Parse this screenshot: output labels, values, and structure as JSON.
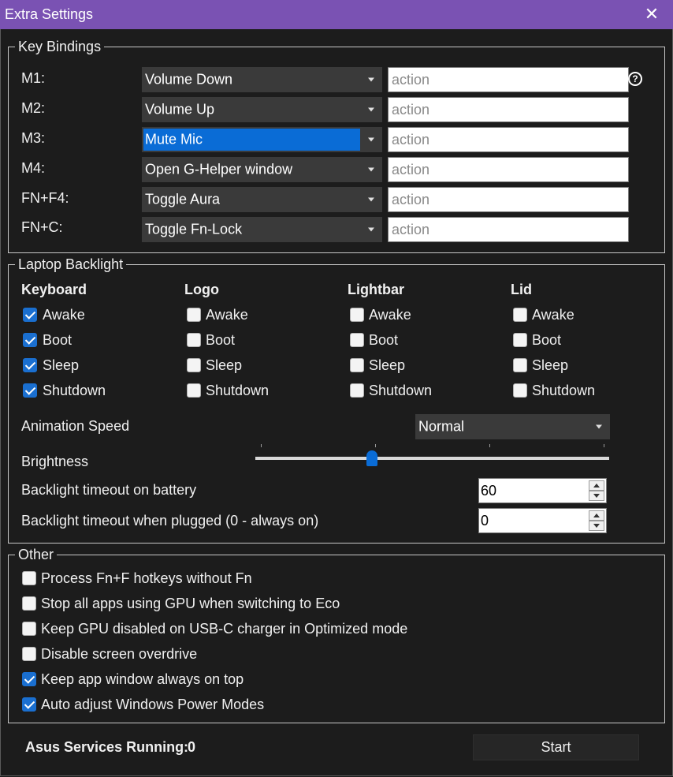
{
  "window": {
    "title": "Extra Settings",
    "close_glyph": "✕"
  },
  "key_bindings": {
    "legend": "Key Bindings",
    "help_glyph": "?",
    "rows": [
      {
        "label": "M1:",
        "action": "Volume Down",
        "placeholder": "action",
        "selected": false
      },
      {
        "label": "M2:",
        "action": "Volume Up",
        "placeholder": "action",
        "selected": false
      },
      {
        "label": "M3:",
        "action": "Mute Mic",
        "placeholder": "action",
        "selected": true
      },
      {
        "label": "M4:",
        "action": "Open G-Helper window",
        "placeholder": "action",
        "selected": false
      },
      {
        "label": "FN+F4:",
        "action": "Toggle Aura",
        "placeholder": "action",
        "selected": false
      },
      {
        "label": "FN+C:",
        "action": "Toggle Fn-Lock",
        "placeholder": "action",
        "selected": false
      }
    ]
  },
  "backlight": {
    "legend": "Laptop Backlight",
    "columns": [
      {
        "header": "Keyboard",
        "items": [
          {
            "label": "Awake",
            "checked": true
          },
          {
            "label": "Boot",
            "checked": true
          },
          {
            "label": "Sleep",
            "checked": true
          },
          {
            "label": "Shutdown",
            "checked": true
          }
        ]
      },
      {
        "header": "Logo",
        "items": [
          {
            "label": "Awake",
            "checked": false
          },
          {
            "label": "Boot",
            "checked": false
          },
          {
            "label": "Sleep",
            "checked": false
          },
          {
            "label": "Shutdown",
            "checked": false
          }
        ]
      },
      {
        "header": "Lightbar",
        "items": [
          {
            "label": "Awake",
            "checked": false
          },
          {
            "label": "Boot",
            "checked": false
          },
          {
            "label": "Sleep",
            "checked": false
          },
          {
            "label": "Shutdown",
            "checked": false
          }
        ]
      },
      {
        "header": "Lid",
        "items": [
          {
            "label": "Awake",
            "checked": false
          },
          {
            "label": "Boot",
            "checked": false
          },
          {
            "label": "Sleep",
            "checked": false
          },
          {
            "label": "Shutdown",
            "checked": false
          }
        ]
      }
    ],
    "animation_speed_label": "Animation Speed",
    "animation_speed_value": "Normal",
    "brightness_label": "Brightness",
    "brightness_fraction": 0.33,
    "timeout_battery_label": "Backlight timeout on battery",
    "timeout_battery_value": "60",
    "timeout_plugged_label": "Backlight timeout when plugged (0 - always on)",
    "timeout_plugged_value": "0"
  },
  "other": {
    "legend": "Other",
    "options": [
      {
        "label": "Process Fn+F hotkeys without Fn",
        "checked": false
      },
      {
        "label": "Stop all apps using GPU when switching to Eco",
        "checked": false
      },
      {
        "label": "Keep GPU disabled on USB-C charger in Optimized mode",
        "checked": false
      },
      {
        "label": "Disable screen overdrive",
        "checked": false
      },
      {
        "label": "Keep app window always on top",
        "checked": true
      },
      {
        "label": "Auto adjust Windows Power Modes",
        "checked": true
      }
    ]
  },
  "footer": {
    "services_label": "Asus Services Running:",
    "services_count": "0",
    "start_label": "Start"
  },
  "colors": {
    "accent": "#7a52b3",
    "selection": "#0a6cd6",
    "checkbox_on": "#1a6fd0",
    "background": "#1c1c1c"
  }
}
